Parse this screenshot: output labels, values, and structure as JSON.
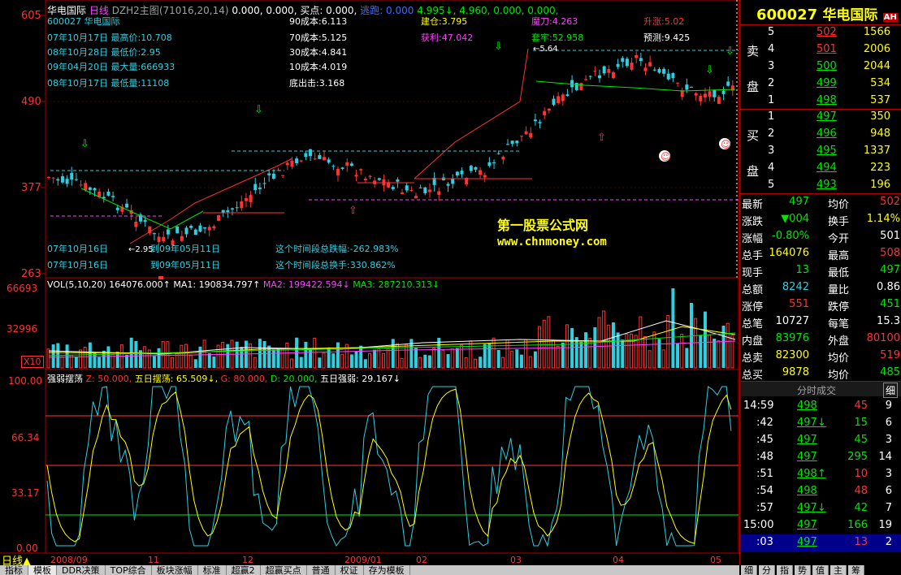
{
  "header": {
    "stock_name": "华电国际",
    "period": "日线",
    "formula": "DZH2主图",
    "formula_params": "(71016,20,14)",
    "values": "0.000, 0.000, 买点: 0.000,",
    "fade_label": "逃跑: 0.000",
    "tail_values": "4.995↓, 4.960, 0.000, 0.000,"
  },
  "price_axis": [
    "605",
    "490",
    "377",
    "263"
  ],
  "info_left": [
    {
      "date": "07年10月17日",
      "label": "最高价:10.708"
    },
    {
      "date": "08年10月28日",
      "label": "最低价:2.95"
    },
    {
      "date": "09年04月20日",
      "label": "最大量:666933"
    },
    {
      "date": "08年10月17日",
      "label": "最低量:11108"
    }
  ],
  "stock_id_line": "600027 华电国际",
  "costs": [
    "90成本:6.113",
    "70成本:5.125",
    "30成本:4.841",
    "10成本:4.019",
    "底出击:3.168"
  ],
  "trade_info": {
    "jiancang": "建仓:3.795",
    "huoli": "获利:47.042",
    "modao": "魔刀:4.263",
    "taolao": "套牢:52.958",
    "shengzhang": "升涨:5.02",
    "yuce": "预测:9.425"
  },
  "price_markers": {
    "high": "5.64",
    "low": "2.95"
  },
  "watermark": {
    "name": "第一股票公式网",
    "url": "www.chnmoney.com"
  },
  "range_info": [
    {
      "from": "07年10月16日",
      "to": "到09年05月11日",
      "text": "这个时间段总跌幅:-262.983%"
    },
    {
      "from": "07年10月16日",
      "to": "到09年05月11日",
      "text": "这个时间段总换手:330.862%"
    }
  ],
  "volume_panel": {
    "axis": [
      "66693",
      "32996",
      "X10"
    ],
    "legend": {
      "vol": "VOL(5,10,20) 164076.000↑",
      "ma1": "MA1: 190834.797↑",
      "ma2": "MA2: 199422.594↓",
      "ma3": "MA3: 287210.313↓"
    }
  },
  "osc_panel": {
    "axis": [
      "100.00",
      "66.34",
      "33.17",
      "0.00"
    ],
    "legend": {
      "name": "强弱摆荡",
      "z": "Z: 50.000,",
      "wuri": "五日摆荡: 65.509↓,",
      "g": "G: 80.000,",
      "d": "D: 20.000,",
      "qiangruo": "五日强弱: 29.167↓"
    }
  },
  "time_axis": [
    "2008/09",
    "11",
    "12",
    "2009/01",
    "02",
    "03",
    "04",
    "05"
  ],
  "period_label": "日线",
  "right_panel": {
    "code": "600027",
    "name": "华电国际",
    "badge": "AH",
    "sell_label": [
      "卖",
      "盘"
    ],
    "buy_label": [
      "买",
      "盘"
    ],
    "sells": [
      {
        "lvl": "5",
        "price": "502",
        "vol": "1566"
      },
      {
        "lvl": "4",
        "price": "501",
        "vol": "2006"
      },
      {
        "lvl": "3",
        "price": "500",
        "vol": "2044"
      },
      {
        "lvl": "2",
        "price": "499",
        "vol": "534"
      },
      {
        "lvl": "1",
        "price": "498",
        "vol": "537"
      }
    ],
    "buys": [
      {
        "lvl": "1",
        "price": "497",
        "vol": "350"
      },
      {
        "lvl": "2",
        "price": "496",
        "vol": "948"
      },
      {
        "lvl": "3",
        "price": "495",
        "vol": "1337"
      },
      {
        "lvl": "4",
        "price": "494",
        "vol": "223"
      },
      {
        "lvl": "5",
        "price": "493",
        "vol": "196"
      }
    ],
    "stats": [
      {
        "k1": "最新",
        "v1": "497",
        "k2": "均价",
        "v2": "502"
      },
      {
        "k1": "涨跌",
        "v1": "▼004",
        "k2": "换手",
        "v2": "1.14%"
      },
      {
        "k1": "涨幅",
        "v1": "-0.80%",
        "k2": "今开",
        "v2": "501"
      },
      {
        "k1": "总手",
        "v1": "164076",
        "k2": "最高",
        "v2": "508"
      },
      {
        "k1": "现手",
        "v1": "13",
        "k2": "最低",
        "v2": "497"
      },
      {
        "k1": "总额",
        "v1": "8242",
        "k2": "量比",
        "v2": "0.86"
      },
      {
        "k1": "涨停",
        "v1": "551",
        "k2": "跌停",
        "v2": "451"
      },
      {
        "k1": "总笔",
        "v1": "10727",
        "k2": "每笔",
        "v2": "15.3"
      },
      {
        "k1": "内盘",
        "v1": "83976",
        "k2": "外盘",
        "v2": "80100"
      },
      {
        "k1": "总卖",
        "v1": "82300",
        "k2": "均价",
        "v2": "519"
      },
      {
        "k1": "总买",
        "v1": "9878",
        "k2": "均价",
        "v2": "485"
      }
    ],
    "ticks_title": "分时成交",
    "ticks_title_btn": "细",
    "ticks": [
      {
        "t": "14:59",
        "p": "498",
        "v": "45",
        "n": "9"
      },
      {
        "t": ":42",
        "p": "497↓",
        "v": "15",
        "n": "6"
      },
      {
        "t": ":45",
        "p": "497",
        "v": "45",
        "n": "3"
      },
      {
        "t": ":48",
        "p": "497",
        "v": "295",
        "n": "14"
      },
      {
        "t": ":51",
        "p": "498↑",
        "v": "10",
        "n": "3"
      },
      {
        "t": ":54",
        "p": "498",
        "v": "48",
        "n": "6"
      },
      {
        "t": ":57",
        "p": "497↓",
        "v": "42",
        "n": "7"
      },
      {
        "t": "15:00",
        "p": "497",
        "v": "166",
        "n": "19"
      },
      {
        "t": ":03",
        "p": "497",
        "v": "13",
        "n": "2"
      }
    ],
    "bottom_tabs": [
      "细",
      "分",
      "指",
      "势",
      "值",
      "主",
      "筹"
    ]
  },
  "bottom_tabs": [
    "指标",
    "模板",
    "DDR决策",
    "TOP综合",
    "板块涨幅",
    "标准",
    "超赢2",
    "超赢买点",
    "普通",
    "权证",
    "存为模板"
  ],
  "colors": {
    "up": "#ff3232",
    "down": "#2fcfe0",
    "grid": "#b00000",
    "accent_yellow": "#ffff00"
  }
}
